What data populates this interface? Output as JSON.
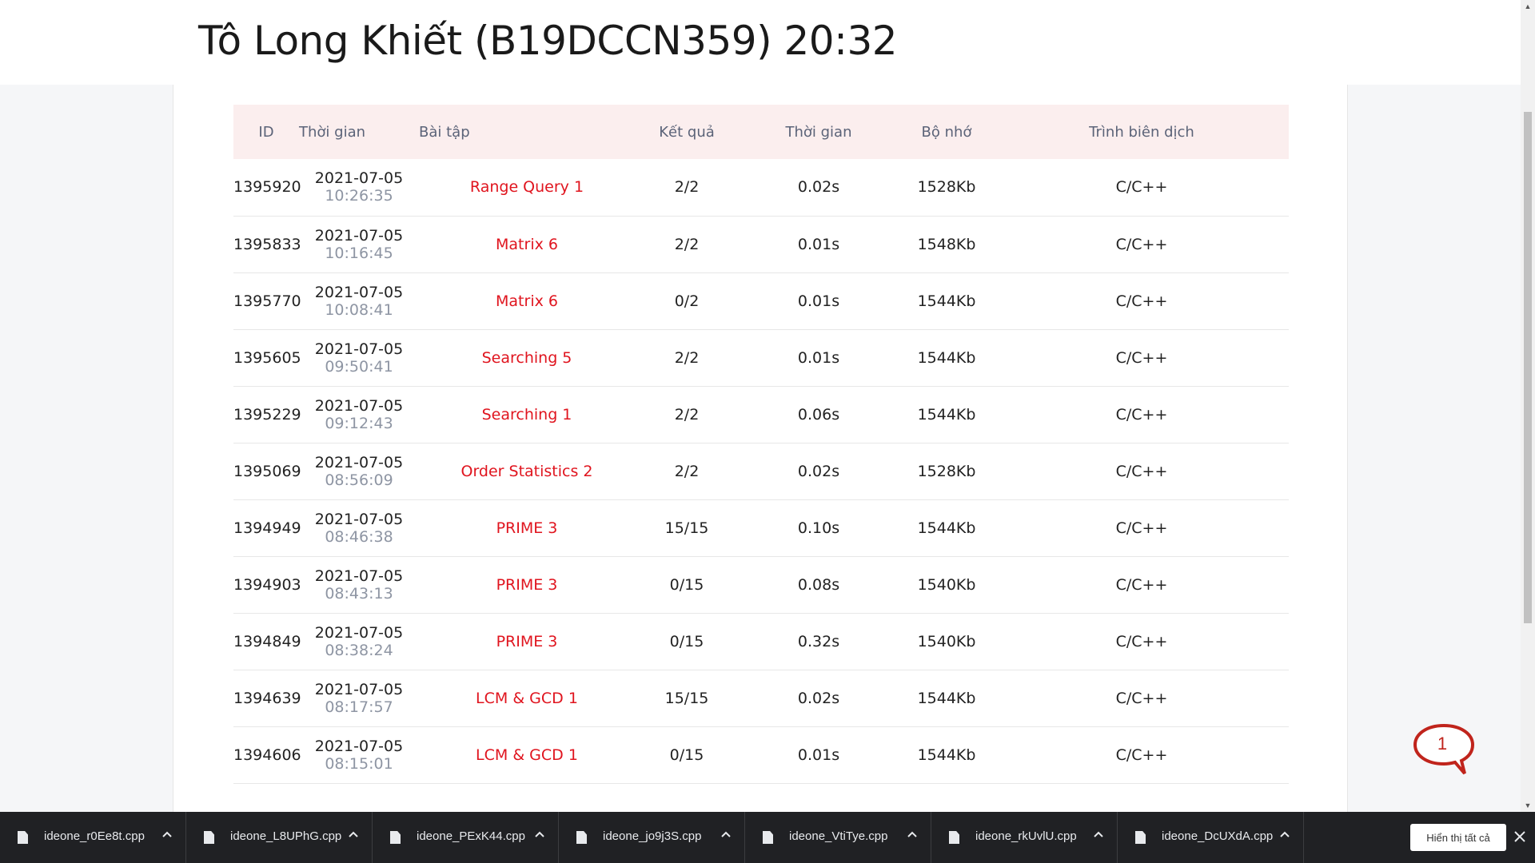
{
  "header": {
    "title": "Tô Long Khiết (B19DCCN359) 20:32"
  },
  "table": {
    "columns": {
      "id": "ID",
      "time": "Thời gian",
      "problem": "Bài tập",
      "result": "Kết quả",
      "run_time": "Thời gian",
      "memory": "Bộ nhớ",
      "compiler": "Trình biên dịch"
    },
    "rows": [
      {
        "id": "1395920",
        "date": "2021-07-05",
        "time": "10:26:35",
        "problem": "Range Query 1",
        "result": "2/2",
        "status": "ok",
        "run_time": "0.02s",
        "memory": "1528Kb",
        "compiler": "C/C++"
      },
      {
        "id": "1395833",
        "date": "2021-07-05",
        "time": "10:16:45",
        "problem": "Matrix 6",
        "result": "2/2",
        "status": "ok",
        "run_time": "0.01s",
        "memory": "1548Kb",
        "compiler": "C/C++"
      },
      {
        "id": "1395770",
        "date": "2021-07-05",
        "time": "10:08:41",
        "problem": "Matrix 6",
        "result": "0/2",
        "status": "fail",
        "run_time": "0.01s",
        "memory": "1544Kb",
        "compiler": "C/C++"
      },
      {
        "id": "1395605",
        "date": "2021-07-05",
        "time": "09:50:41",
        "problem": "Searching 5",
        "result": "2/2",
        "status": "ok",
        "run_time": "0.01s",
        "memory": "1544Kb",
        "compiler": "C/C++"
      },
      {
        "id": "1395229",
        "date": "2021-07-05",
        "time": "09:12:43",
        "problem": "Searching 1",
        "result": "2/2",
        "status": "ok",
        "run_time": "0.06s",
        "memory": "1544Kb",
        "compiler": "C/C++"
      },
      {
        "id": "1395069",
        "date": "2021-07-05",
        "time": "08:56:09",
        "problem": "Order Statistics 2",
        "result": "2/2",
        "status": "ok",
        "run_time": "0.02s",
        "memory": "1528Kb",
        "compiler": "C/C++"
      },
      {
        "id": "1394949",
        "date": "2021-07-05",
        "time": "08:46:38",
        "problem": "PRIME 3",
        "result": "15/15",
        "status": "ok",
        "run_time": "0.10s",
        "memory": "1544Kb",
        "compiler": "C/C++"
      },
      {
        "id": "1394903",
        "date": "2021-07-05",
        "time": "08:43:13",
        "problem": "PRIME 3",
        "result": "0/15",
        "status": "fail",
        "run_time": "0.08s",
        "memory": "1540Kb",
        "compiler": "C/C++"
      },
      {
        "id": "1394849",
        "date": "2021-07-05",
        "time": "08:38:24",
        "problem": "PRIME 3",
        "result": "0/15",
        "status": "fail",
        "run_time": "0.32s",
        "memory": "1540Kb",
        "compiler": "C/C++"
      },
      {
        "id": "1394639",
        "date": "2021-07-05",
        "time": "08:17:57",
        "problem": "LCM & GCD 1",
        "result": "15/15",
        "status": "ok",
        "run_time": "0.02s",
        "memory": "1544Kb",
        "compiler": "C/C++"
      },
      {
        "id": "1394606",
        "date": "2021-07-05",
        "time": "08:15:01",
        "problem": "LCM & GCD 1",
        "result": "0/15",
        "status": "fail",
        "run_time": "0.01s",
        "memory": "1544Kb",
        "compiler": "C/C++"
      }
    ]
  },
  "chat": {
    "badge": "1",
    "color": "#c0241c"
  },
  "colors": {
    "ok": "#22b14c",
    "fail": "#e0141e",
    "header_row": "#fbeeee"
  },
  "downloads": {
    "items": [
      {
        "name": "ideone_r0Ee8t.cpp",
        "icon": "file-icon"
      },
      {
        "name": "ideone_L8UPhG.cpp",
        "icon": "file-icon"
      },
      {
        "name": "ideone_PExK44.cpp",
        "icon": "file-icon"
      },
      {
        "name": "ideone_jo9j3S.cpp",
        "icon": "file-icon"
      },
      {
        "name": "ideone_VtiTye.cpp",
        "icon": "file-icon"
      },
      {
        "name": "ideone_rkUvlU.cpp",
        "icon": "file-icon"
      },
      {
        "name": "ideone_DcUXdA.cpp",
        "icon": "file-icon"
      }
    ],
    "show_all": "Hiển thị tất cả"
  }
}
